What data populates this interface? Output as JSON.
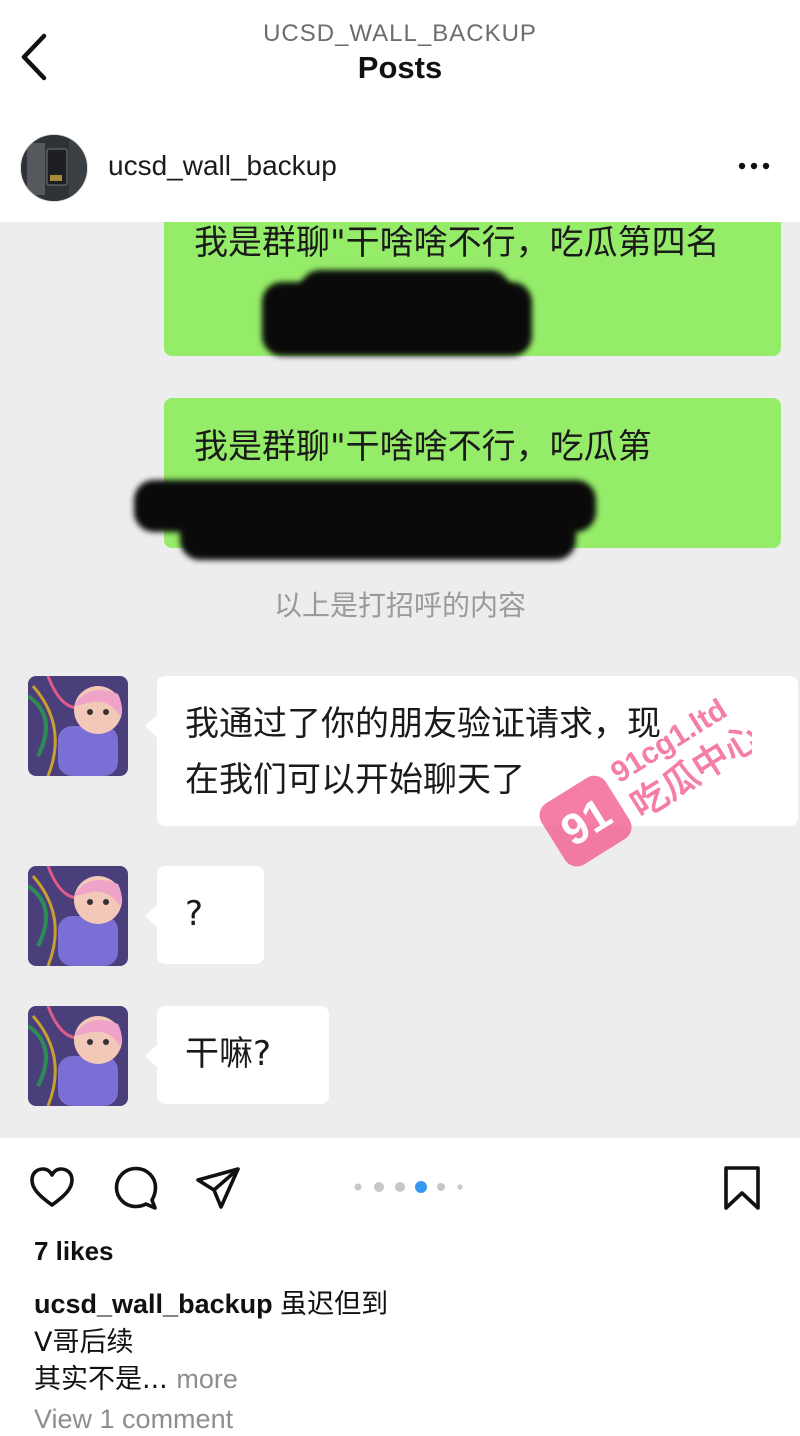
{
  "header": {
    "account_label": "UCSD_WALL_BACKUP",
    "title": "Posts"
  },
  "post": {
    "author": "ucsd_wall_backup"
  },
  "chat": {
    "sent_messages": [
      {
        "text": "我是群聊\"干啥啥不行，吃瓜第四名",
        "redacted": true
      },
      {
        "text": "我是群聊\"干啥啥不行，吃瓜第",
        "redacted": true
      }
    ],
    "system_note": "以上是打招呼的内容",
    "received_messages": [
      {
        "line1": "我通过了你的朋友验证请求，现",
        "line2": "在我们可以开始聊天了"
      },
      {
        "text": "?"
      },
      {
        "text": "干嘛?"
      }
    ],
    "watermark": {
      "badge": "91",
      "url": "91cg1.ltd",
      "name": "吃瓜中心",
      "color": "#f35b8c"
    }
  },
  "actions": {
    "icons": [
      "heart-icon",
      "comment-icon",
      "share-icon",
      "bookmark-icon"
    ],
    "carousel": {
      "total": 6,
      "active_index": 3
    }
  },
  "engagement": {
    "likes": "7 likes",
    "caption_user": "ucsd_wall_backup",
    "caption_line1": "虽迟但到",
    "caption_line2": "V哥后续",
    "caption_line3": "其实不是...",
    "more_label": "more",
    "view_comments": "View 1 comment"
  },
  "colors": {
    "green_bubble": "#95ec69",
    "chat_background": "#ededed"
  }
}
